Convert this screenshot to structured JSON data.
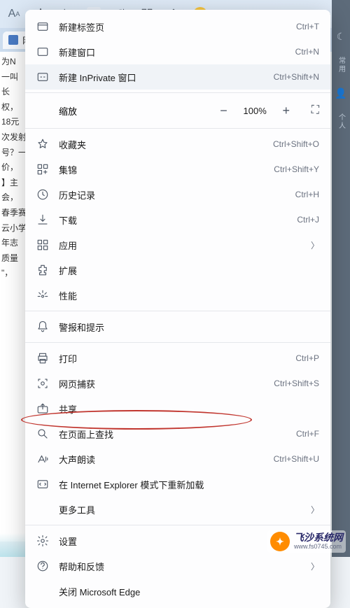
{
  "toolbar": {
    "icons": [
      "text-size-icon",
      "favorite-star-icon",
      "translate-icon",
      "word-icon",
      "refresh-icon",
      "collections-icon",
      "share-icon",
      "profile-icon",
      "more-icon"
    ]
  },
  "tab": {
    "label": "网"
  },
  "right_strip": {
    "items": [
      "常用",
      "个人"
    ]
  },
  "background_lines": [
    "",
    "为N",
    "一叫",
    "长",
    "权，",
    "",
    "18元",
    "次发射",
    "号？一",
    "价，",
    "",
    "",
    "",
    "",
    "】主",
    "会，",
    "春季赛",
    "云小学",
    "年志",
    "质量",
    "\"，"
  ],
  "zoom": {
    "label": "缩放",
    "minus": "−",
    "value": "100%",
    "plus": "+"
  },
  "menu": [
    {
      "icon": "new-tab-icon",
      "label": "新建标签页",
      "shortcut": "Ctrl+T"
    },
    {
      "icon": "new-window-icon",
      "label": "新建窗口",
      "shortcut": "Ctrl+N"
    },
    {
      "icon": "inprivate-icon",
      "label": "新建 InPrivate 窗口",
      "shortcut": "Ctrl+Shift+N",
      "hl": true
    },
    {
      "sep": true
    },
    {
      "zoom": true
    },
    {
      "sep": true
    },
    {
      "icon": "favorites-icon",
      "label": "收藏夹",
      "shortcut": "Ctrl+Shift+O"
    },
    {
      "icon": "collections-icon",
      "label": "集锦",
      "shortcut": "Ctrl+Shift+Y"
    },
    {
      "icon": "history-icon",
      "label": "历史记录",
      "shortcut": "Ctrl+H"
    },
    {
      "icon": "downloads-icon",
      "label": "下载",
      "shortcut": "Ctrl+J"
    },
    {
      "icon": "apps-icon",
      "label": "应用",
      "chev": true
    },
    {
      "icon": "extensions-icon",
      "label": "扩展"
    },
    {
      "icon": "performance-icon",
      "label": "性能"
    },
    {
      "sep": true
    },
    {
      "icon": "alerts-icon",
      "label": "警报和提示"
    },
    {
      "sep": true
    },
    {
      "icon": "print-icon",
      "label": "打印",
      "shortcut": "Ctrl+P"
    },
    {
      "icon": "capture-icon",
      "label": "网页捕获",
      "shortcut": "Ctrl+Shift+S"
    },
    {
      "icon": "share-icon",
      "label": "共享"
    },
    {
      "icon": "find-icon",
      "label": "在页面上查找",
      "shortcut": "Ctrl+F"
    },
    {
      "icon": "read-aloud-icon",
      "label": "大声朗读",
      "shortcut": "Ctrl+Shift+U"
    },
    {
      "icon": "ie-mode-icon",
      "label": "在 Internet Explorer 模式下重新加载"
    },
    {
      "noicon": true,
      "label": "更多工具",
      "chev": true
    },
    {
      "sep": true
    },
    {
      "icon": "settings-icon",
      "label": "设置"
    },
    {
      "icon": "help-icon",
      "label": "帮助和反馈",
      "chev": true
    },
    {
      "noicon": true,
      "label": "关闭 Microsoft Edge"
    }
  ],
  "watermark": {
    "title": "飞沙系统网",
    "url": "www.fs0745.com"
  }
}
